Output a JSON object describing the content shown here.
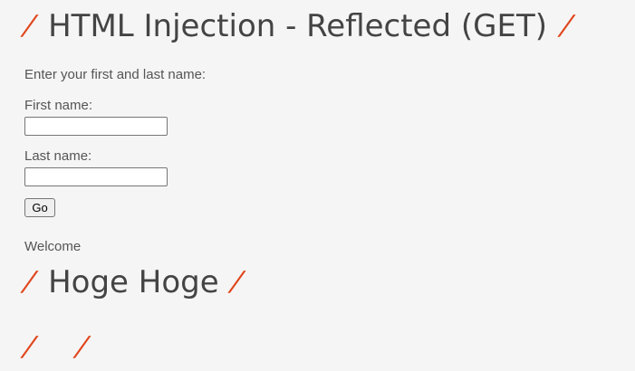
{
  "page": {
    "title": "HTML Injection - Reflected (GET)",
    "title_decorator": "/",
    "instruction": "Enter your first and last name:",
    "form": {
      "first_name_label": "First name:",
      "first_name_value": "",
      "last_name_label": "Last name:",
      "last_name_value": "",
      "submit_label": "Go"
    },
    "welcome_text": "Welcome",
    "reflected_name": "Hoge Hoge",
    "empty_reflection": ""
  },
  "colors": {
    "accent": "#e0461c",
    "text": "#555555",
    "heading": "#444444",
    "background": "#f5f5f5"
  }
}
